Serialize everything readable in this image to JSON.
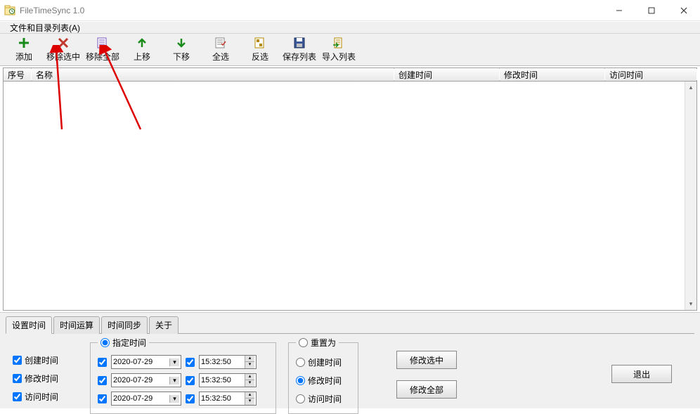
{
  "window": {
    "title": "FileTimeSync 1.0"
  },
  "menubar": {
    "file_list": "文件和目录列表(A)"
  },
  "toolbar": [
    {
      "id": "add",
      "label": "添加",
      "icon": "plus-green"
    },
    {
      "id": "remove-selected",
      "label": "移除选中",
      "icon": "x-red"
    },
    {
      "id": "remove-all",
      "label": "移除全部",
      "icon": "list-purple"
    },
    {
      "id": "move-up",
      "label": "上移",
      "icon": "arrow-up-green"
    },
    {
      "id": "move-down",
      "label": "下移",
      "icon": "arrow-down-green"
    },
    {
      "id": "select-all",
      "label": "全选",
      "icon": "page-select"
    },
    {
      "id": "invert-select",
      "label": "反选",
      "icon": "page-invert"
    },
    {
      "id": "save-list",
      "label": "保存列表",
      "icon": "floppy"
    },
    {
      "id": "import-list",
      "label": "导入列表",
      "icon": "page-import"
    }
  ],
  "columns": {
    "seq": "序号",
    "name": "名称",
    "ctime": "创建时间",
    "mtime": "修改时间",
    "atime": "访问时间"
  },
  "rows": [],
  "tabs": [
    "设置时间",
    "时间运算",
    "时间同步",
    "关于"
  ],
  "active_tab": 0,
  "checks": {
    "create": "创建时间",
    "modify": "修改时间",
    "access": "访问时间"
  },
  "dates_group_label": "指定时间",
  "date1": "2020-07-29",
  "time1": "15:32:50",
  "date2": "2020-07-29",
  "time2": "15:32:50",
  "date3": "2020-07-29",
  "time3": "15:32:50",
  "reset": {
    "group": "重置为",
    "create": "创建时间",
    "modify": "修改时间",
    "access": "访问时间",
    "selected": "modify"
  },
  "buttons": {
    "modify_sel": "修改选中",
    "modify_all": "修改全部",
    "exit": "退出"
  },
  "watermark": {
    "en": "",
    "cn": ""
  }
}
